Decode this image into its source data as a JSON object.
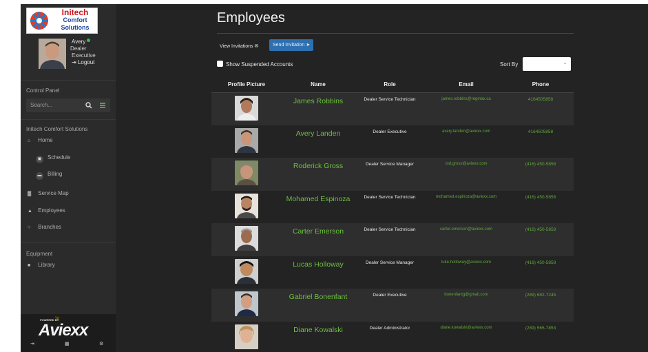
{
  "brand": {
    "logo_line1": "Initech",
    "logo_line2": "Comfort",
    "logo_line3": "Solutions",
    "powered_by": "POWERED BY",
    "platform": "Aviexx"
  },
  "user": {
    "name": "Avery",
    "role_line1": "Dealer",
    "role_line2": "Executive",
    "logout": "Logout",
    "online_color": "#27c93f"
  },
  "sidebar": {
    "control_panel": "Control Panel",
    "search_placeholder": "Search...",
    "company_section": "Initech Comfort Solutions",
    "items": [
      {
        "label": "Home",
        "icon": "home-icon"
      },
      {
        "label": "Schedule",
        "icon": "calendar-icon"
      },
      {
        "label": "Billing",
        "icon": "billing-icon"
      },
      {
        "label": "Service Map",
        "icon": "map-icon"
      },
      {
        "label": "Employees",
        "icon": "users-icon"
      },
      {
        "label": "Branches",
        "icon": "branch-icon"
      }
    ],
    "equipment_section": "Equipment",
    "equipment_items": [
      {
        "label": "Library",
        "icon": "book-icon"
      }
    ]
  },
  "main": {
    "title": "Employees",
    "view_invitations": "View Invitations",
    "send_invitation": "Send Invitation",
    "show_suspended": "Show Suspended Accounts",
    "sort_by": "Sort By",
    "sort_value": ""
  },
  "table": {
    "headers": [
      "Profile Picture",
      "Name",
      "Role",
      "Email",
      "Phone"
    ],
    "rows": [
      {
        "name": "James Robbins",
        "role": "Dealer Service Technician",
        "email": "james.robbins@regmax.ca",
        "phone": "4164505858"
      },
      {
        "name": "Avery Landen",
        "role": "Dealer Executive",
        "email": "avery.landen@aviexx.com",
        "phone": "4164505858"
      },
      {
        "name": "Roderick Gross",
        "role": "Dealer Service Manager",
        "email": "rod.gross@aviexx.com",
        "phone": "(416) 450-5858"
      },
      {
        "name": "Mohamed Espinoza",
        "role": "Dealer Service Technician",
        "email": "mohamed.espinoza@aviexx.com",
        "phone": "(416) 450-5858"
      },
      {
        "name": "Carter Emerson",
        "role": "Dealer Service Technician",
        "email": "carter.emerson@aviexx.com",
        "phone": "(416) 450-5858"
      },
      {
        "name": "Lucas Holloway",
        "role": "Dealer Service Manager",
        "email": "luke.holloway@aviexx.com",
        "phone": "(416) 450-5858"
      },
      {
        "name": "Gabriel Bonenfant",
        "role": "Dealer Executive",
        "email": "bonenfantg@gmail.com",
        "phone": "(289) 682-7245"
      },
      {
        "name": "Diane Kowalski",
        "role": "Dealer Administrator",
        "email": "diane.kowalski@aviexx.com",
        "phone": "(289) 565-7853"
      }
    ]
  },
  "colors": {
    "accent_green": "#6cbf3e",
    "button_blue": "#2d6faf"
  }
}
